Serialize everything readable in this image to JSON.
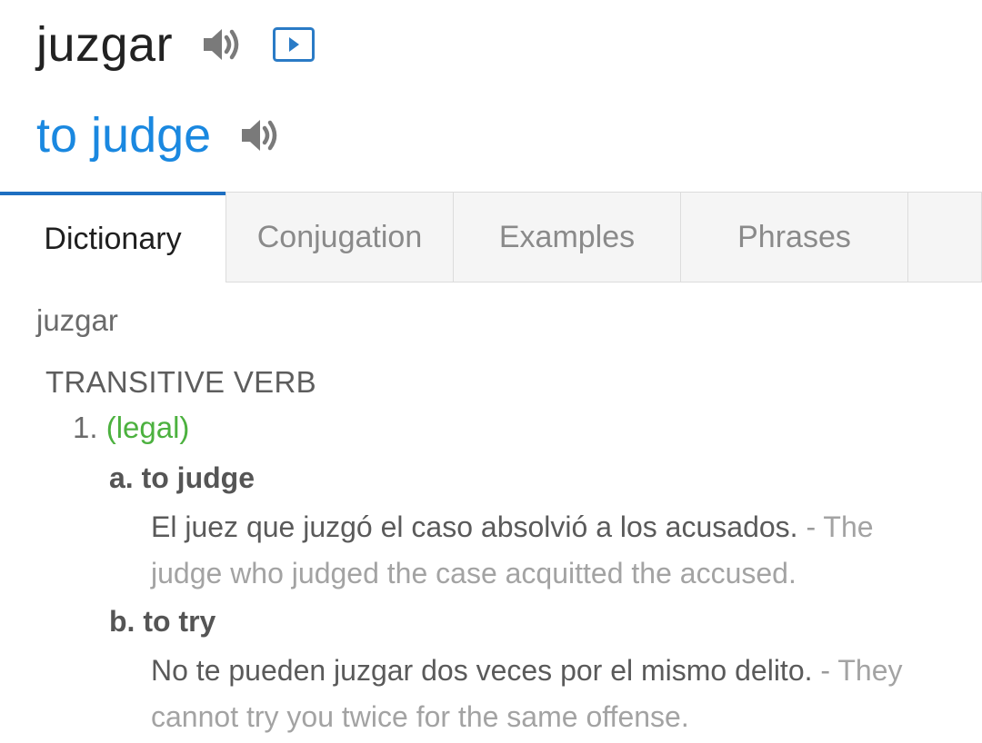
{
  "header": {
    "headword": "juzgar",
    "translation": "to judge",
    "icons": {
      "headword_audio": "speaker-icon",
      "video": "play-video-icon",
      "translation_audio": "speaker-icon"
    },
    "colors": {
      "translation": "#1a88e0",
      "video_icon": "#2a7bc6",
      "speaker_icon": "#7a7a7a"
    }
  },
  "tabs": [
    {
      "label": "Dictionary",
      "active": true
    },
    {
      "label": "Conjugation",
      "active": false
    },
    {
      "label": "Examples",
      "active": false
    },
    {
      "label": "Phrases",
      "active": false
    }
  ],
  "tab_accent_color": "#1e6fc1",
  "entry": {
    "word": "juzgar",
    "part_of_speech": "TRANSITIVE VERB",
    "senses": [
      {
        "number": "1.",
        "tag": "(legal)",
        "tag_color": "#4cb13f",
        "subsenses": [
          {
            "label": "a. to judge",
            "example_es": "El juez que juzgó el caso absolvió a los acusados.",
            "separator": "-",
            "example_en": "The judge who judged the case acquitted the accused."
          },
          {
            "label": "b. to try",
            "example_es": "No te pueden juzgar dos veces por el mismo delito.",
            "separator": "-",
            "example_en": "They cannot try you twice for the same offense."
          }
        ]
      }
    ]
  }
}
